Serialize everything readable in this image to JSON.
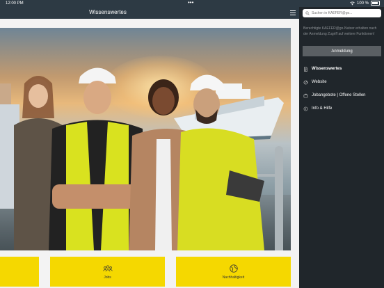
{
  "status_bar": {
    "time": "12:00 PM",
    "dots": "•••",
    "battery": "100 %"
  },
  "nav": {
    "title": "Wissenswertes"
  },
  "tiles": [
    {
      "label": "",
      "icon": "partial-tile"
    },
    {
      "label": "Jobs",
      "icon": "people-group-icon"
    },
    {
      "label": "Nachhaltigkeit",
      "icon": "globe-icon"
    }
  ],
  "drawer": {
    "search_placeholder": "Suchen in KAEFER@go...",
    "info_text": "Berechtigte KAEFER@go-Nutzer erhalten nach der Anmeldung Zugriff auf weitere Funktionen!",
    "login_label": "Anmeldung",
    "items": [
      {
        "label": "Wissenswertes",
        "icon": "document-icon",
        "active": true
      },
      {
        "label": "Website",
        "icon": "globe-icon",
        "active": false
      },
      {
        "label": "Jobangebote | Offene Stellen",
        "icon": "briefcase-icon",
        "active": false
      },
      {
        "label": "Info & Hilfe",
        "icon": "info-icon",
        "active": false
      }
    ]
  },
  "colors": {
    "header": "#2d3a44",
    "drawer": "#20262b",
    "accent_yellow": "#f5d800"
  }
}
